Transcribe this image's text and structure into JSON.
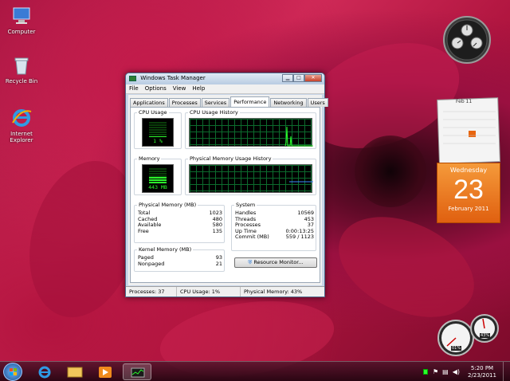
{
  "desktop": {
    "icons": [
      {
        "label": "Computer"
      },
      {
        "label": "Recycle Bin"
      },
      {
        "label": "Internet Explorer"
      }
    ]
  },
  "window": {
    "title": "Windows Task Manager",
    "menu": [
      "File",
      "Options",
      "View",
      "Help"
    ],
    "tabs": [
      "Applications",
      "Processes",
      "Services",
      "Performance",
      "Networking",
      "Users"
    ],
    "active_tab": "Performance",
    "cpu_usage": {
      "label": "CPU Usage",
      "value": "1 %",
      "percent": 1
    },
    "cpu_history": {
      "label": "CPU Usage History"
    },
    "memory": {
      "label": "Memory",
      "value": "443 MB",
      "percent": 43
    },
    "memory_history": {
      "label": "Physical Memory Usage History"
    },
    "physical_memory": {
      "label": "Physical Memory (MB)",
      "rows": [
        {
          "k": "Total",
          "v": "1023"
        },
        {
          "k": "Cached",
          "v": "480"
        },
        {
          "k": "Available",
          "v": "580"
        },
        {
          "k": "Free",
          "v": "135"
        }
      ]
    },
    "kernel_memory": {
      "label": "Kernel Memory (MB)",
      "rows": [
        {
          "k": "Paged",
          "v": "93"
        },
        {
          "k": "Nonpaged",
          "v": "21"
        }
      ]
    },
    "system": {
      "label": "System",
      "rows": [
        {
          "k": "Handles",
          "v": "10569"
        },
        {
          "k": "Threads",
          "v": "453"
        },
        {
          "k": "Processes",
          "v": "37"
        },
        {
          "k": "Up Time",
          "v": "0:00:13:25"
        },
        {
          "k": "Commit (MB)",
          "v": "559 / 1123"
        }
      ]
    },
    "resource_monitor_button": "Resource Monitor...",
    "status": {
      "processes": "Processes: 37",
      "cpu": "CPU Usage: 1%",
      "memory": "Physical Memory: 43%"
    }
  },
  "gadgets": {
    "calendar": {
      "month_label": "Feb 11",
      "weekday": "Wednesday",
      "day": "23",
      "month_year": "February 2011"
    },
    "cpu_meter": {
      "cpu": "01%",
      "memory": "43%"
    }
  },
  "taskbar": {
    "time": "5:20 PM",
    "date": "2/23/2011"
  },
  "colors": {
    "accent_green": "#2cff2c",
    "calendar_orange": "#e8650e"
  }
}
